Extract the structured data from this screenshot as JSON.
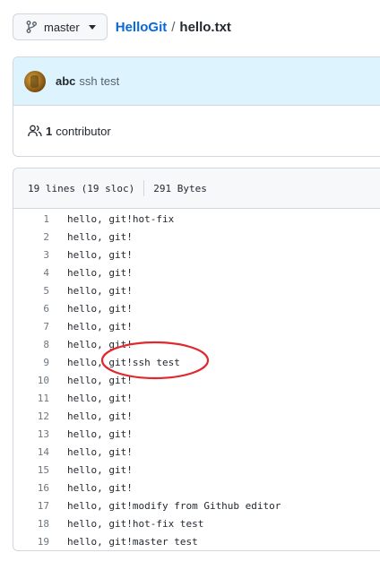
{
  "topbar": {
    "branch_label": "master",
    "branch_icon": "git-branch-icon",
    "caret_icon": "caret-down-icon",
    "repo_name": "HelloGit",
    "separator": "/",
    "file_name": "hello.txt"
  },
  "commit": {
    "author": "abc",
    "message": "ssh test"
  },
  "contributors": {
    "count": "1",
    "label": "contributor",
    "icon": "people-icon"
  },
  "file": {
    "lines_info": "19 lines (19 sloc)",
    "size": "291 Bytes",
    "lines": [
      {
        "n": "1",
        "text": "hello, git!hot-fix"
      },
      {
        "n": "2",
        "text": "hello, git!"
      },
      {
        "n": "3",
        "text": "hello, git!"
      },
      {
        "n": "4",
        "text": "hello, git!"
      },
      {
        "n": "5",
        "text": "hello, git!"
      },
      {
        "n": "6",
        "text": "hello, git!"
      },
      {
        "n": "7",
        "text": "hello, git!"
      },
      {
        "n": "8",
        "text": "hello, git!"
      },
      {
        "n": "9",
        "text": "hello, git!ssh test"
      },
      {
        "n": "10",
        "text": "hello, git!"
      },
      {
        "n": "11",
        "text": "hello, git!"
      },
      {
        "n": "12",
        "text": "hello, git!"
      },
      {
        "n": "13",
        "text": "hello, git!"
      },
      {
        "n": "14",
        "text": "hello, git!"
      },
      {
        "n": "15",
        "text": "hello, git!"
      },
      {
        "n": "16",
        "text": "hello, git!"
      },
      {
        "n": "17",
        "text": "hello, git!modify from Github editor"
      },
      {
        "n": "18",
        "text": "hello, git!hot-fix test"
      },
      {
        "n": "19",
        "text": "hello, git!master test"
      }
    ]
  },
  "colors": {
    "link": "#0969da",
    "annotation": "#e0282e",
    "commit_bg": "#ddf4ff"
  }
}
